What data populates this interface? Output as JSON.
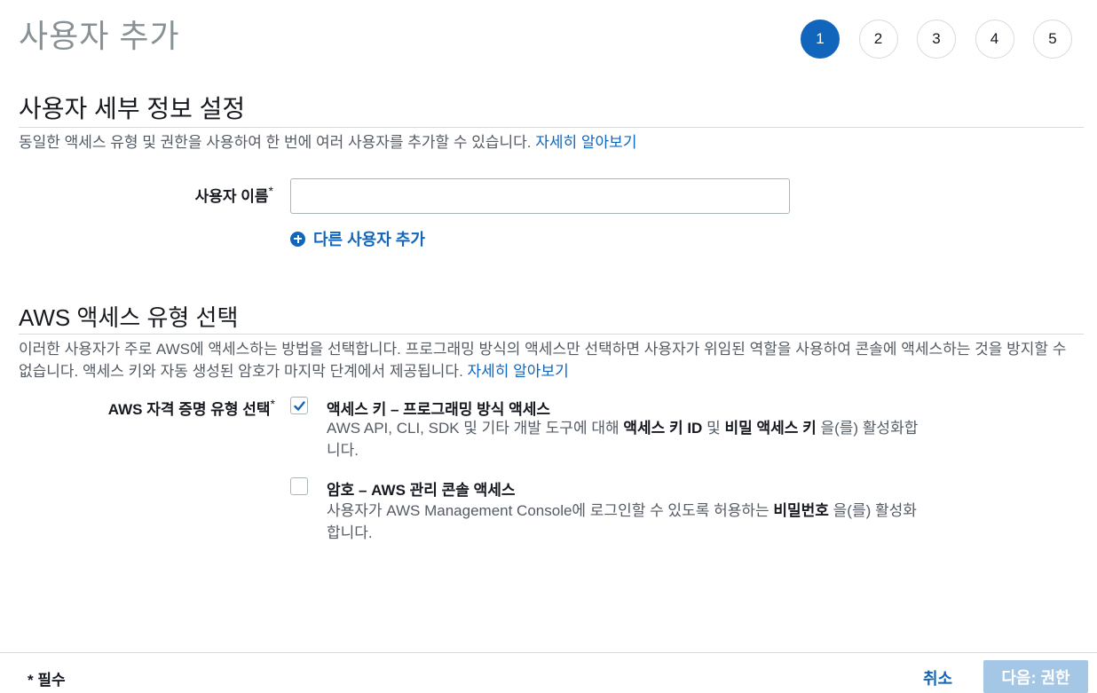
{
  "page": {
    "title": "사용자 추가"
  },
  "steps": [
    {
      "label": "1",
      "active": true
    },
    {
      "label": "2",
      "active": false
    },
    {
      "label": "3",
      "active": false
    },
    {
      "label": "4",
      "active": false
    },
    {
      "label": "5",
      "active": false
    }
  ],
  "user_details": {
    "title": "사용자 세부 정보 설정",
    "description": "동일한 액세스 유형 및 권한을 사용하여 한 번에 여러 사용자를 추가할 수 있습니다. ",
    "learn_more": "자세히 알아보기",
    "username_label": "사용자 이름",
    "required_mark": "*",
    "username_value": "",
    "add_user_label": "다른 사용자 추가"
  },
  "access_type": {
    "title": "AWS 액세스 유형 선택",
    "description": "이러한 사용자가 주로 AWS에 액세스하는 방법을 선택합니다. 프로그래밍 방식의 액세스만 선택하면 사용자가 위임된 역할을 사용하여 콘솔에 액세스하는 것을 방지할 수 없습니다. 액세스 키와 자동 생성된 암호가 마지막 단계에서 제공됩니다. ",
    "learn_more": "자세히 알아보기",
    "credential_label": "AWS 자격 증명 유형 선택",
    "required_mark": "*",
    "options": [
      {
        "title": "액세스 키 – 프로그래밍 방식 액세스",
        "checked": true,
        "desc_pre": "AWS API, CLI, SDK 및 기타 개발 도구에 대해 ",
        "desc_bold1": "액세스 키 ID",
        "desc_mid": " 및 ",
        "desc_bold2": "비밀 액세스 키",
        "desc_post": " 을(를) 활성화합니다."
      },
      {
        "title": "암호 – AWS 관리 콘솔 액세스",
        "checked": false,
        "desc_pre": "사용자가 AWS Management Console에 로그인할 수 있도록 허용하는 ",
        "desc_bold1": "비밀번호",
        "desc_post": " 을(를) 활성화합니다."
      }
    ]
  },
  "footer": {
    "required_note": "* 필수",
    "cancel_label": "취소",
    "next_label": "다음: 권한"
  },
  "colors": {
    "accent": "#1166bb",
    "next_disabled": "#a5c7e6",
    "title_gray": "#879196"
  }
}
